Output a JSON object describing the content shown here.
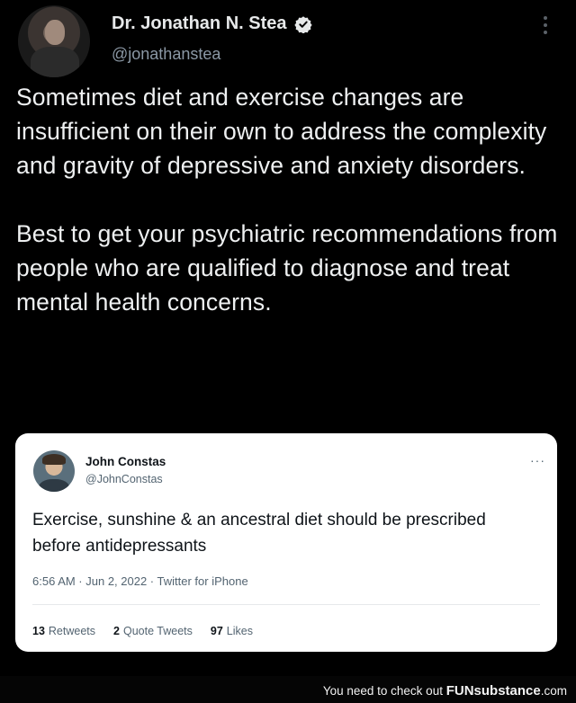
{
  "tweet": {
    "display_name": "Dr. Jonathan N. Stea",
    "handle": "@jonathanstea",
    "verified_icon": "verified-badge-icon",
    "paragraphs": [
      "Sometimes diet and exercise changes are insufficient on their own to address the complexity and gravity of depressive and anxiety disorders.",
      "Best to get your psychiatric recommendations from people who are qualified to diagnose and treat mental health concerns."
    ]
  },
  "quoted": {
    "display_name": "John Constas",
    "handle": "@JohnConstas",
    "more": "···",
    "text": "Exercise, sunshine & an ancestral diet should be prescribed before antidepressants",
    "meta": "6:56 AM · Jun 2, 2022 · Twitter for iPhone",
    "stats": [
      {
        "count": "13",
        "label": "Retweets"
      },
      {
        "count": "2",
        "label": "Quote Tweets"
      },
      {
        "count": "97",
        "label": "Likes"
      }
    ]
  },
  "footer": {
    "prefix": "You need to check out ",
    "brand": "FUNsubstance",
    "suffix": ".com"
  },
  "colors": {
    "background": "#000000",
    "verified_blue": "#e7e9ea",
    "quote_bg": "#ffffff",
    "secondary_text": "#8b98a5"
  }
}
